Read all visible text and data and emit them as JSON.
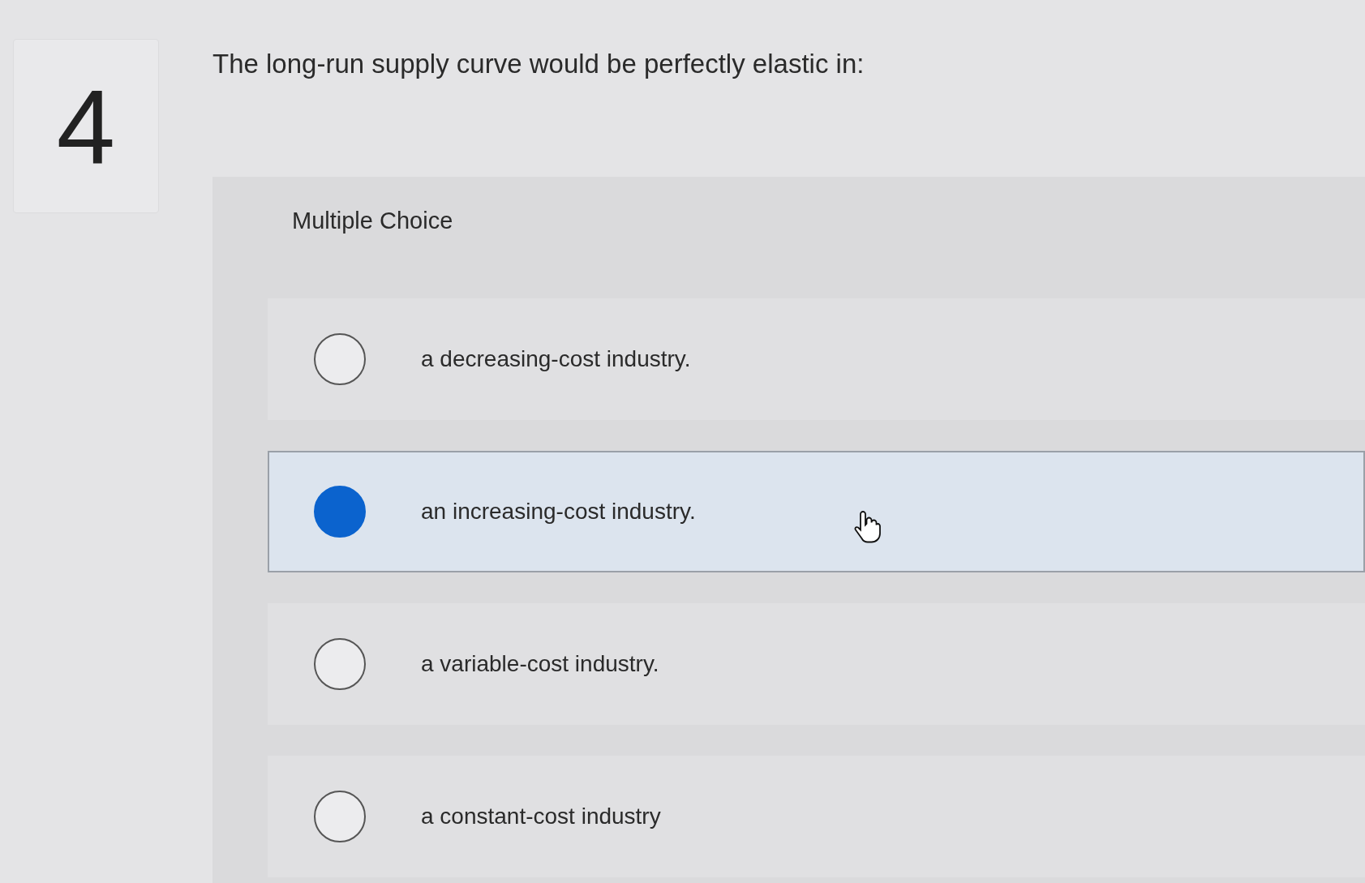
{
  "question_number": "4",
  "question": "The long-run supply curve would be perfectly elastic in:",
  "answer_type": "Multiple Choice",
  "options": [
    {
      "label": "a decreasing-cost industry.",
      "selected": false
    },
    {
      "label": "an increasing-cost industry.",
      "selected": true
    },
    {
      "label": "a variable-cost industry.",
      "selected": false
    },
    {
      "label": "a constant-cost industry",
      "selected": false
    }
  ]
}
